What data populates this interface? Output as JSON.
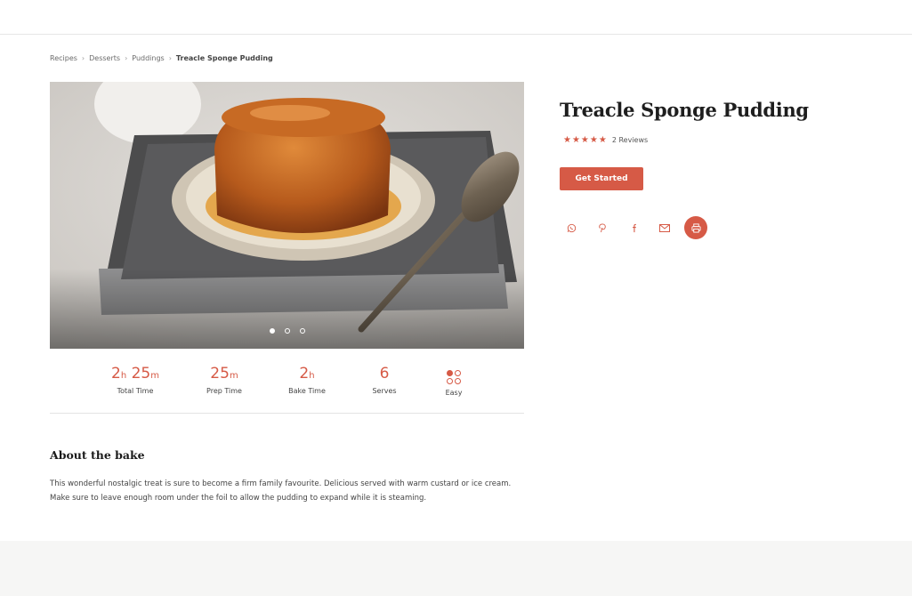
{
  "breadcrumb": {
    "items": [
      "Recipes",
      "Desserts",
      "Puddings"
    ],
    "current": "Treacle Sponge Pudding",
    "separator": "›"
  },
  "hero": {
    "image_alt": "Treacle sponge pudding on a plate",
    "slides": 3,
    "active_slide": 1
  },
  "stats": {
    "total": {
      "h": "2",
      "h_unit": "h",
      "m": "25",
      "m_unit": "m",
      "label": "Total Time"
    },
    "prep": {
      "m": "25",
      "m_unit": "m",
      "label": "Prep Time"
    },
    "bake": {
      "h": "2",
      "h_unit": "h",
      "label": "Bake Time"
    },
    "serves": {
      "value": "6",
      "label": "Serves"
    },
    "difficulty": {
      "label": "Easy",
      "level": 1,
      "max_level": 4
    }
  },
  "about": {
    "heading": "About the bake",
    "text": "This wonderful nostalgic treat is sure to become a firm family favourite. Delicious served with warm custard or ice cream. Make sure to leave enough room under the foil to allow the pudding to expand while it is steaming."
  },
  "recipe": {
    "title": "Treacle Sponge Pudding",
    "stars": "★★★★★",
    "rating": 5,
    "reviews": "2 Reviews",
    "cta_label": "Get Started"
  },
  "share": {
    "icons": [
      "whatsapp-icon",
      "pinterest-icon",
      "facebook-icon",
      "email-icon",
      "print-icon"
    ]
  },
  "colors": {
    "accent": "#d65a46",
    "footer_band": "#f6f6f5"
  }
}
